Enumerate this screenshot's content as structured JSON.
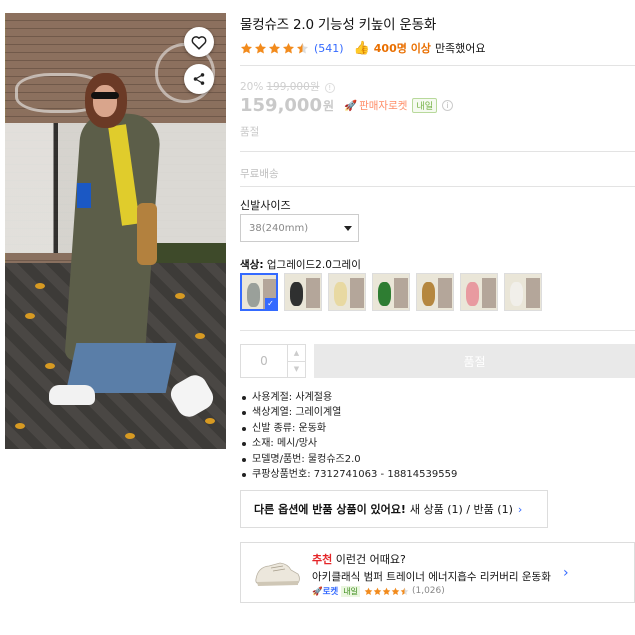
{
  "product": {
    "title": "물컹슈즈 2.0 기능성 키높이 운동화",
    "rating_value": 4.5,
    "review_count": "(541)",
    "satisfaction_icon": "thumbs-up-icon",
    "satisfaction_strong": "400명 이상",
    "satisfaction_rest": "만족했어요"
  },
  "price": {
    "discount_rate": "20%",
    "original_price": "199,000원",
    "sale_price": "159,000",
    "unit": "원",
    "seller_rocket": "판매자로켓",
    "tomorrow_badge": "내일",
    "status": "품절",
    "shipping": "무료배송"
  },
  "options": {
    "size_label": "신발사이즈",
    "size_selected": "38(240mm)",
    "color_label": "색상:",
    "color_selected": "업그레이드2.0그레이",
    "swatches": [
      {
        "shoe_color": "#9aa09a",
        "selected": true
      },
      {
        "shoe_color": "#2f3030",
        "selected": false
      },
      {
        "shoe_color": "#e8d9a2",
        "selected": false
      },
      {
        "shoe_color": "#2e7d32",
        "selected": false
      },
      {
        "shoe_color": "#b5873f",
        "selected": false
      },
      {
        "shoe_color": "#e89aa0",
        "selected": false
      },
      {
        "shoe_color": "#f1efea",
        "selected": false
      }
    ]
  },
  "purchase": {
    "quantity": "0",
    "buy_label": "품절"
  },
  "specs": [
    "사용계절: 사계절용",
    "색상계열: 그레이계열",
    "신발 종류: 운동화",
    "소재: 메시/망사",
    "모델명/품번: 물컹슈즈2.0",
    "쿠팡상품번호: 7312741063 - 18814539559"
  ],
  "return_notice": {
    "strong": "다른 옵션에 반품 상품이 있어요!",
    "rest": "새 상품 (1) / 반품 (1)"
  },
  "recommendation": {
    "prefix": "추천",
    "heading": "이런건 어때요?",
    "name": "아키클래식 범퍼 트레이너 에너지흡수 리커버리 운동화",
    "rocket": "로켓",
    "tomorrow": "내일",
    "rating_value": 4.5,
    "review_count": "(1,026)"
  },
  "colors": {
    "accent_blue": "#346aff",
    "star": "#f28b1d",
    "highlight_orange": "#e96f00"
  }
}
